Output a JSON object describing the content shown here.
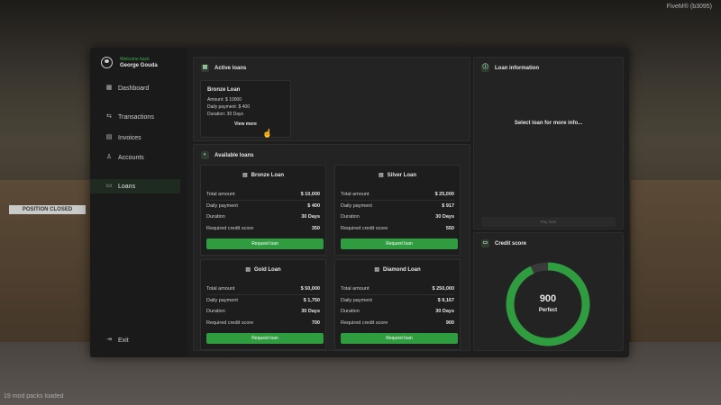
{
  "hud": {
    "top_right": "FiveM® (b3095)",
    "bottom_left": "19 mod packs loaded"
  },
  "background": {
    "sign": "POSITION CLOSED"
  },
  "user": {
    "welcome": "Welcome back",
    "name": "George Gouda"
  },
  "nav": {
    "dashboard": "Dashboard",
    "transactions": "Transactions",
    "invoices": "Invoices",
    "accounts": "Accounts",
    "loans": "Loans",
    "exit": "Exit"
  },
  "active_loans": {
    "title": "Active loans",
    "card": {
      "name": "Bronze Loan",
      "amount": "Amount: $ 10000",
      "daily": "Daily payment: $ 400",
      "duration": "Duration: 30 Days",
      "view_more": "View more"
    }
  },
  "available_loans": {
    "title": "Available loans",
    "labels": {
      "total": "Total amount",
      "daily": "Daily payment",
      "duration": "Duration",
      "score": "Required credit score",
      "button": "Request loan"
    },
    "loans": [
      {
        "name": "Bronze Loan",
        "total": "$ 10,000",
        "daily": "$ 400",
        "duration": "30 Days",
        "score": "350"
      },
      {
        "name": "Silver Loan",
        "total": "$ 25,000",
        "daily": "$ 917",
        "duration": "30 Days",
        "score": "550"
      },
      {
        "name": "Gold Loan",
        "total": "$ 50,000",
        "daily": "$ 1,750",
        "duration": "30 Days",
        "score": "700"
      },
      {
        "name": "Diamond Loan",
        "total": "$ 250,000",
        "daily": "$ 9,167",
        "duration": "30 Days",
        "score": "900"
      }
    ]
  },
  "loan_info": {
    "title": "Loan information",
    "empty": "Select loan for more info...",
    "pay_button": "Pay loan"
  },
  "credit_score": {
    "title": "Credit score",
    "value": "900",
    "label": "Perfect",
    "fill_fraction": 0.93,
    "color": "#2e9c3f",
    "track_color": "#3a3a3a"
  }
}
